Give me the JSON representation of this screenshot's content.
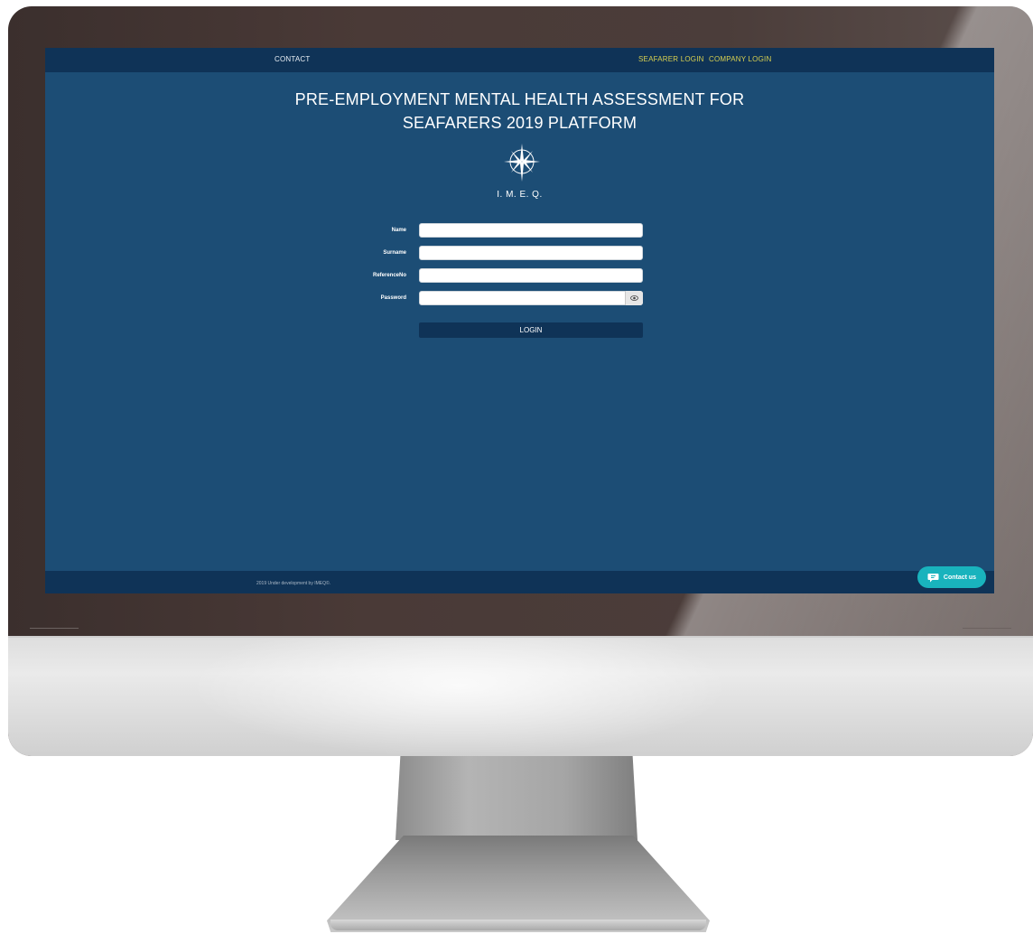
{
  "nav": {
    "contact": "CONTACT",
    "seafarer_login": "SEAFARER LOGIN",
    "company_login": "COMPANY LOGIN"
  },
  "title": {
    "line1": "PRE-EMPLOYMENT MENTAL HEALTH ASSESSMENT FOR",
    "line2": "SEAFARERS 2019 PLATFORM"
  },
  "logo": {
    "text": "I. M. E. Q."
  },
  "form": {
    "name_label": "Name",
    "surname_label": "Surname",
    "reference_label": "ReferenceNo",
    "password_label": "Password",
    "login_button": "LOGIN"
  },
  "footer": {
    "text": "2019 Under development by IMEQ©."
  },
  "chat": {
    "label": "Contact us"
  },
  "colors": {
    "screen_bg": "#1c4d75",
    "nav_bg": "#0f3357",
    "nav_link": "#d8d050",
    "chat_bg": "#19b3bd"
  }
}
